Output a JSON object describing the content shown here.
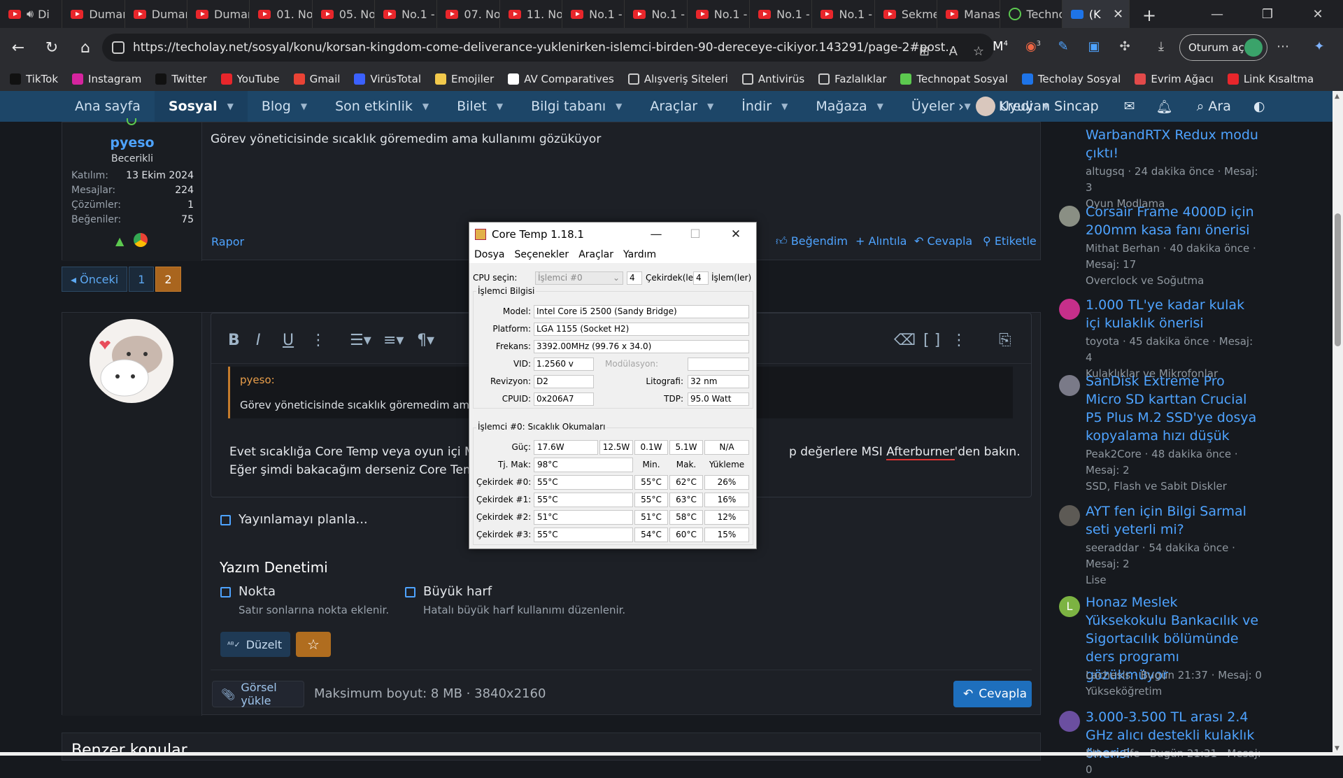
{
  "browser": {
    "tabs": [
      {
        "label": "Di",
        "icon": "youtube-icon"
      },
      {
        "label": "Duman",
        "icon": "youtube-icon"
      },
      {
        "label": "Duman",
        "icon": "youtube-icon"
      },
      {
        "label": "Duman",
        "icon": "youtube-icon"
      },
      {
        "label": "01. No",
        "icon": "youtube-icon"
      },
      {
        "label": "05. No",
        "icon": "youtube-icon"
      },
      {
        "label": "No.1 -",
        "icon": "youtube-icon"
      },
      {
        "label": "07. No",
        "icon": "youtube-icon"
      },
      {
        "label": "11. No",
        "icon": "youtube-icon"
      },
      {
        "label": "No.1 -",
        "icon": "youtube-icon"
      },
      {
        "label": "No.1 -",
        "icon": "youtube-icon"
      },
      {
        "label": "No.1 -",
        "icon": "youtube-icon"
      },
      {
        "label": "No.1 -",
        "icon": "youtube-icon"
      },
      {
        "label": "No.1 -",
        "icon": "youtube-icon"
      },
      {
        "label": "Sekme",
        "icon": "youtube-icon"
      },
      {
        "label": "Manas",
        "icon": "youtube-icon"
      },
      {
        "label": "Techno",
        "icon": "technopat-icon"
      },
      {
        "label": "(K",
        "icon": "techolay-icon",
        "active": true
      }
    ],
    "url": "https://techolay.net/sosyal/konu/korsan-kingdom-come-deliverance-yuklenirken-islemci-birden-90-dereceye-cikiyor.143291/page-2#post...",
    "signin_label": "Oturum aç",
    "ext_badges": [
      "4",
      "3"
    ],
    "bookmarks": [
      {
        "label": "TikTok",
        "icon": "tiktok-icon",
        "color": "#111111"
      },
      {
        "label": "Instagram",
        "icon": "instagram-icon",
        "color": "#d6249f"
      },
      {
        "label": "Twitter",
        "icon": "x-icon",
        "color": "#111111"
      },
      {
        "label": "YouTube",
        "icon": "youtube-icon",
        "color": "#e8262b"
      },
      {
        "label": "Gmail",
        "icon": "gmail-icon",
        "color": "#ea4335"
      },
      {
        "label": "VirüsTotal",
        "icon": "virustotal-icon",
        "color": "#3b61ff"
      },
      {
        "label": "Emojiler",
        "icon": "folder-icon",
        "color": "#f2c94c"
      },
      {
        "label": "AV Comparatives",
        "icon": "av-icon",
        "color": "#ffffff"
      },
      {
        "label": "Alışveriş Siteleri",
        "icon": "folder-icon",
        "color": ""
      },
      {
        "label": "Antivirüs",
        "icon": "folder-icon",
        "color": ""
      },
      {
        "label": "Fazlalıklar",
        "icon": "folder-icon",
        "color": ""
      },
      {
        "label": "Technopat Sosyal",
        "icon": "technopat-icon",
        "color": "#5cc94f"
      },
      {
        "label": "Techolay Sosyal",
        "icon": "techolay-icon",
        "color": "#1e74e8"
      },
      {
        "label": "Evrim Ağacı",
        "icon": "evrim-icon",
        "color": "#e24a4a"
      },
      {
        "label": "Link Kısaltma",
        "icon": "link-icon",
        "color": "#e8262b"
      }
    ]
  },
  "site_nav": {
    "items": [
      {
        "label": "Ana sayfa",
        "caret": false
      },
      {
        "label": "Sosyal",
        "caret": true,
        "active": true
      },
      {
        "label": "Blog",
        "caret": true
      },
      {
        "label": "Son etkinlik",
        "caret": true
      },
      {
        "label": "Bilet",
        "caret": true
      },
      {
        "label": "Bilgi tabanı",
        "caret": true
      },
      {
        "label": "Araçlar",
        "caret": true
      },
      {
        "label": "İndir",
        "caret": true
      },
      {
        "label": "Mağaza",
        "caret": true
      },
      {
        "label": "Üyeler",
        "caret": true
      },
      {
        "label": "Kredi",
        "caret": true
      }
    ],
    "username": "Uyuyan Sincap",
    "search_label": "Ara"
  },
  "post": {
    "author": "pyeso",
    "rank": "Becerikli",
    "stats": [
      {
        "label": "Katılım:",
        "value": "13 Ekim 2024"
      },
      {
        "label": "Mesajlar:",
        "value": "224"
      },
      {
        "label": "Çözümler:",
        "value": "1"
      },
      {
        "label": "Beğeniler:",
        "value": "75"
      }
    ],
    "text": "Görev yöneticisinde sıcaklık göremedim ama kullanımı gözüküyor",
    "report": "Rapor",
    "actions": [
      "Beğendim",
      "+ Alıntıla",
      "Cevapla",
      "Etiketle"
    ]
  },
  "pager": {
    "prev": "◂ Önceki",
    "pages": [
      "1",
      "2"
    ],
    "current": "2"
  },
  "editor": {
    "quote_author": "pyeso:",
    "quote_text": "Görev yöneticisinde sıcaklık göremedim ama k",
    "line1_a": "Evet sıcaklığa Core Temp veya oyun içi MS",
    "line1_b": "p değerlere MSI ",
    "line1_c": "Afterburner",
    "line1_d": "'den bakın.",
    "line2": "Eğer şimdi bakacağım derseniz Core Temp",
    "schedule": "Yayınlamayı planla...",
    "spell_header": "Yazım Denetimi",
    "opt1_label": "Nokta",
    "opt1_desc": "Satır sonlarına nokta eklenir.",
    "opt2_label": "Büyük harf",
    "opt2_desc": "Hatalı büyük harf kullanımı düzenlenir.",
    "fix_label": "Düzelt",
    "upload_label": "Görsel yükle",
    "max_size": "Maksimum boyut: 8 MB · 3840x2160",
    "reply_label": "Cevapla"
  },
  "similar_title": "Benzer konular",
  "sidebar": [
    {
      "title": "WarbandRTX Redux modu çıktı!",
      "meta": "altugsq · 24 dakika önce · Mesaj: 3",
      "forum": "Oyun Modlama",
      "avatar": ""
    },
    {
      "title": "Corsair Frame 4000D için 200mm kasa fanı önerisi",
      "meta": "Mithat Berhan · 40 dakika önce · Mesaj: 17",
      "forum": "Overclock ve Soğutma",
      "avatar": "#8a8f84"
    },
    {
      "title": "1.000 TL'ye kadar kulak içi kulaklık önerisi",
      "meta": "toyota · 45 dakika önce · Mesaj: 4",
      "forum": "Kulaklıklar ve Mikrofonlar",
      "avatar": "#c62f8a"
    },
    {
      "title": "SanDisk Extreme Pro Micro SD karttan Crucial P5 Plus M.2 SSD'ye dosya kopyalama hızı düşük",
      "meta": "Peak2Core · 48 dakika önce · Mesaj: 2",
      "forum": "SSD, Flash ve Sabit Diskler",
      "avatar": "#7a7a88"
    },
    {
      "title": "AYT fen için Bilgi Sarmal seti yeterli mi?",
      "meta": "seeraddar · 54 dakika önce · Mesaj: 2",
      "forum": "Lise",
      "avatar": "#5d5a55"
    },
    {
      "title": "Honaz Meslek Yüksekokulu Bankacılık ve Sigortacılık bölümünde ders programı gözükmüyor",
      "meta": "Lachesis · Bugün 21:37 · Mesaj: 0",
      "forum": "Yükseköğretim",
      "avatar": "#7cb342",
      "letter": "L"
    },
    {
      "title": "3.000-3.500 TL arası 2.4 GHz alıcı destekli kulaklık önerisi",
      "meta": "Ethem Efe · Bugün 21:31 · Mesaj: 0",
      "forum": "",
      "avatar": "#6b4fa0"
    }
  ],
  "coretemp": {
    "title": "Core Temp 1.18.1",
    "menu": [
      "Dosya",
      "Seçenekler",
      "Araçlar",
      "Yardım"
    ],
    "cpu_select_label": "CPU seçin:",
    "cpu_select_value": "İşlemci #0",
    "cores_count": "4",
    "cores_label": "Çekirdek(le",
    "threads_count": "4",
    "threads_label": "İşlem(ler)",
    "info_group": "İşlemci Bilgisi",
    "model_label": "Model:",
    "model": "Intel Core i5 2500 (Sandy Bridge)",
    "platform_label": "Platform:",
    "platform": "LGA 1155 (Socket H2)",
    "freq_label": "Frekans:",
    "freq": "3392.00MHz (99.76 x 34.0)",
    "vid_label": "VID:",
    "vid": "1.2560 v",
    "mod_label": "Modülasyon:",
    "mod": "",
    "rev_label": "Revizyon:",
    "rev": "D2",
    "litho_label": "Litografi:",
    "litho": "32 nm",
    "cpuid_label": "CPUID:",
    "cpuid": "0x206A7",
    "tdp_label": "TDP:",
    "tdp": "95.0 Watt",
    "temp_group": "İşlemci #0: Sıcaklık Okumaları",
    "power_label": "Güç:",
    "power": [
      "17.6W",
      "12.5W",
      "0.1W",
      "5.1W",
      "N/A"
    ],
    "tj_label": "Tj. Mak:",
    "tj": "98°C",
    "col_min": "Min.",
    "col_max": "Mak.",
    "col_load": "Yükleme",
    "cores": [
      {
        "label": "Çekirdek #0:",
        "temp": "55°C",
        "min": "55°C",
        "max": "62°C",
        "load": "26%"
      },
      {
        "label": "Çekirdek #1:",
        "temp": "55°C",
        "min": "55°C",
        "max": "63°C",
        "load": "16%"
      },
      {
        "label": "Çekirdek #2:",
        "temp": "51°C",
        "min": "51°C",
        "max": "58°C",
        "load": "12%"
      },
      {
        "label": "Çekirdek #3:",
        "temp": "55°C",
        "min": "54°C",
        "max": "60°C",
        "load": "15%"
      }
    ]
  }
}
